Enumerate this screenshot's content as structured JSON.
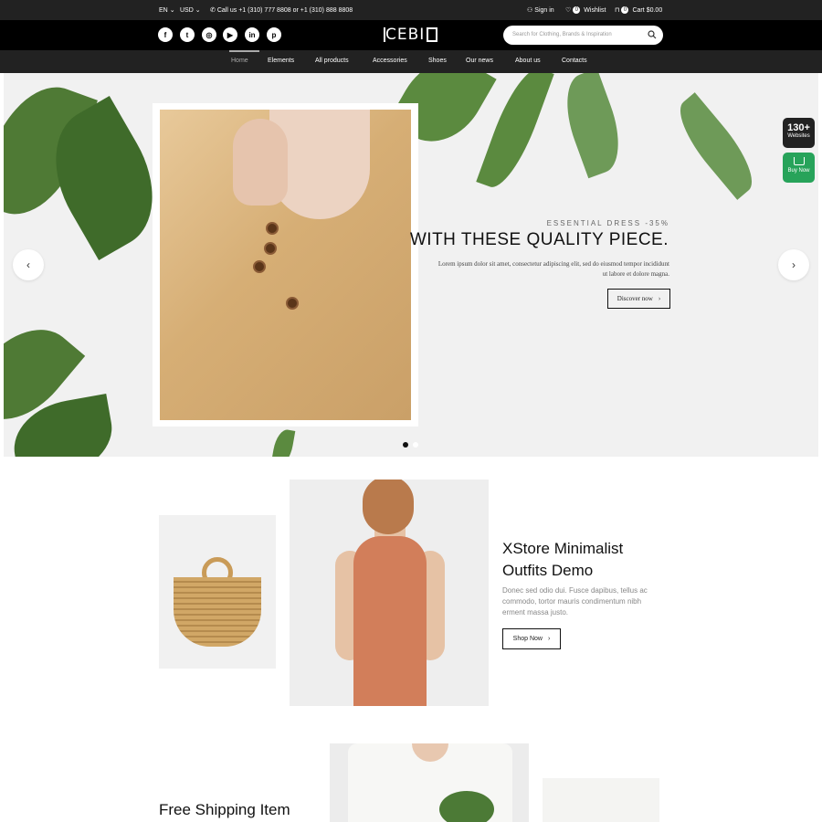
{
  "topbar": {
    "language": "EN",
    "currency": "USD",
    "phone": "Call us +1 (310) 777 8808 or +1 (310) 888 8808",
    "sign_in": "Sign in",
    "wishlist": "Wishlist",
    "wishlist_count": "0",
    "cart": "Cart",
    "cart_count": "0",
    "cart_total": "$0.00"
  },
  "header": {
    "logo": "CEBI",
    "search_placeholder": "Search for Clothing, Brands & Inspiration",
    "social": [
      {
        "icon": "facebook-icon",
        "glyph": "f"
      },
      {
        "icon": "twitter-icon",
        "glyph": "t"
      },
      {
        "icon": "instagram-icon",
        "glyph": "◎"
      },
      {
        "icon": "youtube-icon",
        "glyph": "▶"
      },
      {
        "icon": "linkedin-icon",
        "glyph": "in"
      },
      {
        "icon": "pinterest-icon",
        "glyph": "p"
      }
    ]
  },
  "nav": {
    "items": [
      {
        "label": "Home",
        "active": true
      },
      {
        "label": "Elements"
      },
      {
        "label": "All products"
      },
      {
        "label": "Accessories"
      },
      {
        "label": "Shoes"
      },
      {
        "label": "Our news"
      },
      {
        "label": "About us"
      },
      {
        "label": "Contacts"
      }
    ]
  },
  "hero": {
    "subtitle": "ESSENTIAL DRESS -35%",
    "headline": "WITH THESE QUALITY PIECE.",
    "body": "Lorem ipsum dolor sit amet, consectetur adipiscing elit, sed do eiusmod tempor incididunt ut labore et dolore magna.",
    "cta": "Discover now",
    "prev": "‹",
    "next": "›",
    "slide_count": 2,
    "active_slide": 1
  },
  "side": {
    "badge_count": "130+",
    "badge_label": "Websites",
    "buy_now": "Buy Now"
  },
  "promo": {
    "title": "XStore Minimalist Outfits Demo",
    "desc": "Donec sed odio dui. Fusce dapibus, tellus ac commodo, tortor mauris condimentum nibh erment massa justo.",
    "button": "Shop Now"
  },
  "bottom": {
    "title": "Free Shipping Item"
  },
  "colors": {
    "topbar_bg": "#222222",
    "header_bg": "#000000",
    "buy_now": "#27a35a"
  }
}
